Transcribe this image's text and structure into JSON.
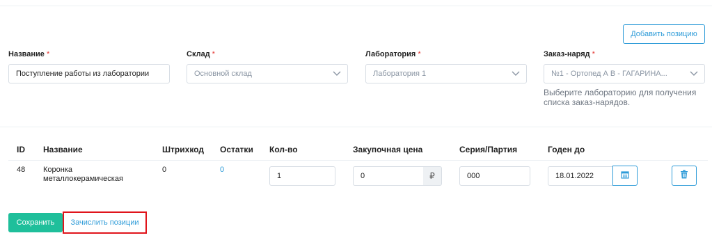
{
  "toolbar": {
    "add_position_label": "Добавить позицию"
  },
  "form": {
    "name": {
      "label": "Название",
      "required_mark": "*",
      "value": "Поступление работы из лаборатории"
    },
    "warehouse": {
      "label": "Склад",
      "required_mark": "*",
      "value": "Основной склад"
    },
    "laboratory": {
      "label": "Лаборатория",
      "required_mark": "*",
      "value": "Лаборатория 1"
    },
    "work_order": {
      "label": "Заказ-наряд",
      "required_mark": "*",
      "value": "№1 - Ортопед А В - ГАГАРИНА...",
      "hint": "Выберите лабораторию для получения списка заказ-нарядов."
    }
  },
  "table": {
    "headers": {
      "id": "ID",
      "name": "Название",
      "barcode": "Штрихкод",
      "stock": "Остатки",
      "qty": "Кол-во",
      "purchase_price": "Закупочная цена",
      "series": "Серия/Партия",
      "expiry": "Годен до"
    },
    "rows": [
      {
        "id": "48",
        "name_line1": "Коронка",
        "name_line2": "металлокерамическая",
        "barcode": "0",
        "stock": "0",
        "qty": "1",
        "price": "0",
        "currency": "₽",
        "series": "000",
        "expiry": "18.01.2022"
      }
    ]
  },
  "footer": {
    "save_label": "Сохранить",
    "credit_label": "Зачислить позиции"
  },
  "colors": {
    "accent": "#2d9bd8",
    "save": "#1fbf9b",
    "required": "#e53935",
    "highlight": "#e0141b"
  },
  "icons": [
    "chevron-down-icon",
    "calendar-icon",
    "trash-icon"
  ]
}
